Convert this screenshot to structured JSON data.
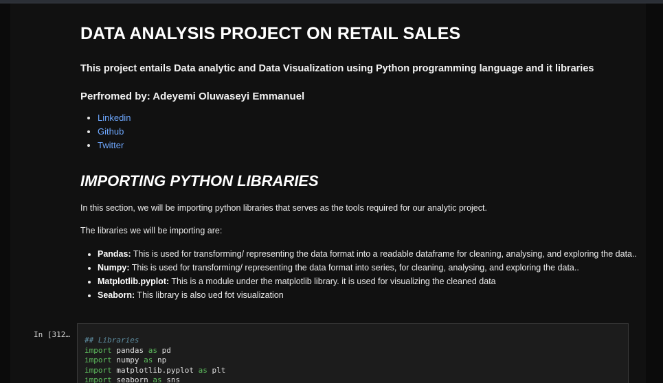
{
  "notebook": {
    "title": "DATA ANALYSIS PROJECT ON RETAIL SALES",
    "subtitle": "This project entails Data analytic and Data Visualization using Python programming language and it libraries",
    "author": "Perfromed by: Adeyemi Oluwaseyi Emmanuel",
    "links": [
      {
        "label": "Linkedin"
      },
      {
        "label": "Github"
      },
      {
        "label": "Twitter"
      }
    ],
    "section_title": "IMPORTING PYTHON LIBRARIES",
    "intro": "In this section, we will be importing python libraries that serves as the tools required for our analytic project.",
    "libs_intro": "The libraries we will be importing are:",
    "libraries": [
      {
        "name": "Pandas:",
        "desc": " This is used for transforming/ representing the data format into a readable dataframe for cleaning, analysing, and exploring the data.."
      },
      {
        "name": "Numpy:",
        "desc": " This is used for transforming/ representing the data format into series, for cleaning, analysing, and exploring the data.."
      },
      {
        "name": "Matplotlib.pyplot:",
        "desc": " This is a module under the matplotlib library. it is used for visualizing the cleaned data"
      },
      {
        "name": "Seaborn:",
        "desc": " This library is also ued fot visualization"
      }
    ]
  },
  "code_cell": {
    "prompt": "In [312…",
    "comment": "## Libraries",
    "lines": [
      {
        "kw1": "import",
        "mod": " pandas ",
        "kw2": "as",
        "alias": " pd"
      },
      {
        "kw1": "import",
        "mod": " numpy ",
        "kw2": "as",
        "alias": " np"
      },
      {
        "kw1": "import",
        "mod": " matplotlib.pyplot ",
        "kw2": "as",
        "alias": " plt"
      },
      {
        "kw1": "import",
        "mod": " seaborn ",
        "kw2": "as",
        "alias": " sns"
      }
    ]
  },
  "colors": {
    "background": "#111111",
    "link": "#6ea8ff",
    "keyword": "#5fbf5f",
    "comment": "#5f8fa3"
  }
}
